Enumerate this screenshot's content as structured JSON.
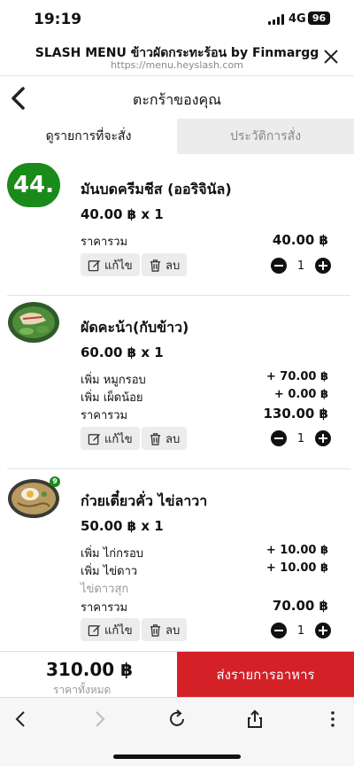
{
  "status_bar": {
    "time": "19:19",
    "network": "4G",
    "battery": "96"
  },
  "browser": {
    "site_title": "SLASH MENU ข้าวผัดกระทะร้อน by Finmargg",
    "url": "https://menu.heyslash.com"
  },
  "page": {
    "title": "ตะกร้าของคุณ"
  },
  "tabs": [
    {
      "label": "ดูรายการที่จะสั่ง",
      "active": true
    },
    {
      "label": "ประวัติการสั่ง",
      "active": false
    }
  ],
  "items": [
    {
      "image_text": "44.",
      "name": "มันบดครีมชีส (ออริจินัล)",
      "price_line": "40.00 ฿ x 1",
      "extras": [],
      "total_label": "ราคารวม",
      "total": "40.00 ฿",
      "edit_label": "แก้ไข",
      "delete_label": "ลบ",
      "quantity": "1"
    },
    {
      "name": "ผัดคะน้า(กับข้าว)",
      "price_line": "60.00 ฿ x 1",
      "extras": [
        {
          "label": "เพิ่ม หมูกรอบ",
          "value": "+ 70.00 ฿"
        },
        {
          "label": "เพิ่ม เผ็ดน้อย",
          "value": "+ 0.00 ฿"
        }
      ],
      "total_label": "ราคารวม",
      "total": "130.00 ฿",
      "edit_label": "แก้ไข",
      "delete_label": "ลบ",
      "quantity": "1"
    },
    {
      "badge": "9",
      "name": "ก๋วยเตี๋ยวคั่ว ไข่ลาวา",
      "price_line": "50.00 ฿ x 1",
      "extras": [
        {
          "label": "เพิ่ม ไก่กรอบ",
          "value": "+ 10.00 ฿"
        },
        {
          "label": "เพิ่ม ไข่ดาว",
          "value": "+ 10.00 ฿"
        }
      ],
      "note": "ไข่ดาวสุก",
      "total_label": "ราคารวม",
      "total": "70.00 ฿",
      "edit_label": "แก้ไข",
      "delete_label": "ลบ",
      "quantity": "1"
    }
  ],
  "footer": {
    "grand_total": "310.00 ฿",
    "grand_total_label": "ราคาทั้งหมด",
    "submit_label": "ส่งรายการอาหาร"
  },
  "colors": {
    "accent": "#d42027",
    "logo_green": "#1a8a1a"
  }
}
